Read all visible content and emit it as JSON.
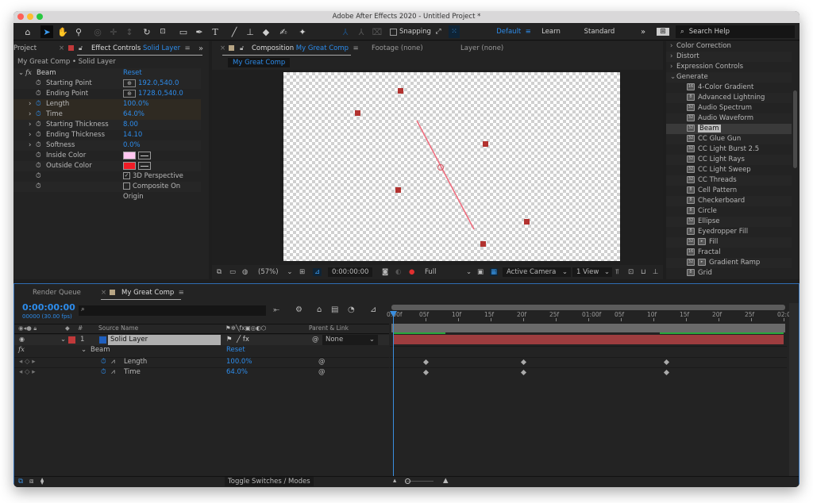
{
  "window": {
    "title": "Adobe After Effects 2020 - Untitled Project *"
  },
  "toolbar": {
    "snapping_label": "Snapping",
    "workspaces": [
      "Default",
      "Learn",
      "Standard"
    ],
    "overflow": "»",
    "search_placeholder": "Search Help"
  },
  "left_panel": {
    "project_tab": "Project",
    "effect_controls_tab": "Effect Controls",
    "effect_controls_layer": "Solid Layer",
    "overflow": "»",
    "breadcrumb": "My Great Comp • Solid Layer",
    "effect_name": "Beam",
    "reset_label": "Reset",
    "properties": [
      {
        "name": "Starting Point",
        "value": "192.0,540.0",
        "type": "point",
        "expandable": false,
        "keyframed": false
      },
      {
        "name": "Ending Point",
        "value": "1728.0,540.0",
        "type": "point",
        "expandable": false,
        "keyframed": false
      },
      {
        "name": "Length",
        "value": "100.0%",
        "type": "number",
        "expandable": true,
        "keyframed": true
      },
      {
        "name": "Time",
        "value": "64.0%",
        "type": "number",
        "expandable": true,
        "keyframed": true
      },
      {
        "name": "Starting Thickness",
        "value": "8.00",
        "type": "number",
        "expandable": true,
        "keyframed": false
      },
      {
        "name": "Ending Thickness",
        "value": "14.10",
        "type": "number",
        "expandable": true,
        "keyframed": false
      },
      {
        "name": "Softness",
        "value": "0.0%",
        "type": "number",
        "expandable": true,
        "keyframed": false
      },
      {
        "name": "Inside Color",
        "value": "#ffc6f0",
        "type": "color",
        "expandable": false,
        "keyframed": false
      },
      {
        "name": "Outside Color",
        "value": "#f01c26",
        "type": "color",
        "expandable": false,
        "keyframed": false
      },
      {
        "name": "",
        "value": "3D Perspective",
        "type": "checkbox",
        "checked": true,
        "expandable": false,
        "keyframed": false
      },
      {
        "name": "",
        "value": "Composite On Origin",
        "type": "checkbox",
        "checked": false,
        "expandable": false,
        "keyframed": false
      }
    ]
  },
  "comp_panel": {
    "tab_label": "Composition",
    "comp_name": "My Great Comp",
    "footage_tab": "Footage (none)",
    "layer_tab": "Layer (none)",
    "comp_chip": "My Great Comp",
    "zoom": "(57%)",
    "timecode": "0:00:00:00",
    "resolution": "Full",
    "camera": "Active Camera",
    "views": "1 View"
  },
  "effects_panel": {
    "categories": [
      {
        "label": "Color Correction",
        "expanded": false
      },
      {
        "label": "Distort",
        "expanded": false
      },
      {
        "label": "Expression Controls",
        "expanded": false
      },
      {
        "label": "Generate",
        "expanded": true
      }
    ],
    "items": [
      {
        "label": "4-Color Gradient",
        "bpc": "16",
        "extra": false
      },
      {
        "label": "Advanced Lightning",
        "bpc": "8",
        "extra": false
      },
      {
        "label": "Audio Spectrum",
        "bpc": "32",
        "extra": false
      },
      {
        "label": "Audio Waveform",
        "bpc": "32",
        "extra": false
      },
      {
        "label": "Beam",
        "bpc": "32",
        "extra": false,
        "selected": true
      },
      {
        "label": "CC Glue Gun",
        "bpc": "32",
        "extra": false
      },
      {
        "label": "CC Light Burst 2.5",
        "bpc": "32",
        "extra": false
      },
      {
        "label": "CC Light Rays",
        "bpc": "32",
        "extra": false
      },
      {
        "label": "CC Light Sweep",
        "bpc": "32",
        "extra": false
      },
      {
        "label": "CC Threads",
        "bpc": "32",
        "extra": false
      },
      {
        "label": "Cell Pattern",
        "bpc": "8",
        "extra": false
      },
      {
        "label": "Checkerboard",
        "bpc": "8",
        "extra": false
      },
      {
        "label": "Circle",
        "bpc": "8",
        "extra": false
      },
      {
        "label": "Ellipse",
        "bpc": "32",
        "extra": false
      },
      {
        "label": "Eyedropper Fill",
        "bpc": "8",
        "extra": false
      },
      {
        "label": "Fill",
        "bpc": "32",
        "extra": true
      },
      {
        "label": "Fractal",
        "bpc": "16",
        "extra": false
      },
      {
        "label": "Gradient Ramp",
        "bpc": "32",
        "extra": true
      },
      {
        "label": "Grid",
        "bpc": "8",
        "extra": false
      }
    ]
  },
  "timeline": {
    "render_queue_tab": "Render Queue",
    "comp_tab": "My Great Comp",
    "timecode": "0:00:00:00",
    "frame_info": "00000 (30.00 fps)",
    "search_placeholder": "",
    "columns": {
      "num": "#",
      "source_name": "Source Name",
      "parent": "Parent & Link"
    },
    "layer": {
      "num": "1",
      "name": "Solid Layer",
      "parent": "None",
      "label_color": "#c1393a",
      "color_chip": "#1f5fbf"
    },
    "effect_name": "Beam",
    "reset_label": "Reset",
    "properties": [
      {
        "name": "Length",
        "value": "100.0%",
        "keyframes_frames": [
          5,
          20,
          42
        ]
      },
      {
        "name": "Time",
        "value": "64.0%",
        "keyframes_frames": [
          5,
          20,
          42
        ]
      }
    ],
    "ruler_ticks": [
      "0:00f",
      "05f",
      "10f",
      "15f",
      "20f",
      "25f",
      "01:00f",
      "05f",
      "10f",
      "15f",
      "20f",
      "25f",
      "02:0"
    ],
    "duration_frames": 60,
    "fps": 30,
    "current_frame": 0,
    "toggle_label": "Toggle Switches / Modes"
  }
}
